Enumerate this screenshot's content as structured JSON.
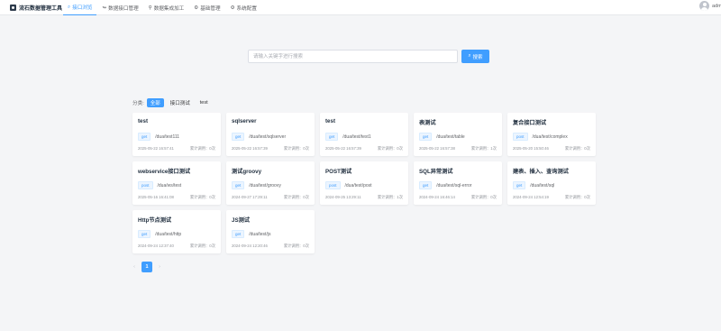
{
  "app": {
    "title": "流石数据管理工具"
  },
  "nav": [
    {
      "label": "接口浏览",
      "icon": "search-icon",
      "glyph": "⌕",
      "active": true
    },
    {
      "label": "数据接口管理",
      "icon": "link-icon",
      "glyph": "↬",
      "active": false
    },
    {
      "label": "数据集成加工",
      "icon": "integration-icon",
      "glyph": "⚲",
      "active": false
    },
    {
      "label": "基础管理",
      "icon": "settings-icon",
      "glyph": "⚙",
      "active": false
    },
    {
      "label": "系统配置",
      "icon": "gear-icon",
      "glyph": "⚙",
      "active": false
    }
  ],
  "user": {
    "name": "admin"
  },
  "search": {
    "placeholder": "请输入关键字进行搜索",
    "value": "",
    "button_label": "搜索",
    "button_icon": "search-icon"
  },
  "filter": {
    "label": "分类:",
    "chips": [
      {
        "label": "全部",
        "active": true
      },
      {
        "label": "接口测试",
        "active": false
      },
      {
        "label": "test",
        "active": false
      }
    ]
  },
  "cards": [
    {
      "title": "test",
      "method": "get",
      "path": "/dua/test111",
      "time": "2025-05-22 16:57:41",
      "calls": "累计调用：0次"
    },
    {
      "title": "sqlserver",
      "method": "get",
      "path": "/dua/test/sqlserver",
      "time": "2025-05-22 16:57:39",
      "calls": "累计调用：0次"
    },
    {
      "title": "test",
      "method": "get",
      "path": "/dua/test/test1",
      "time": "2025-05-22 16:57:39",
      "calls": "累计调用：0次"
    },
    {
      "title": "表测试",
      "method": "get",
      "path": "/dua/test/table",
      "time": "2025-05-22 16:57:38",
      "calls": "累计调用：1次"
    },
    {
      "title": "复合接口测试",
      "method": "post",
      "path": "/dua/test/complex",
      "time": "2025-05-20 15:50:46",
      "calls": "累计调用：0次"
    },
    {
      "title": "webservice接口测试",
      "method": "post",
      "path": "/dua/ws/test",
      "time": "2025-05-16 16:41:08",
      "calls": "累计调用：0次"
    },
    {
      "title": "测试groovy",
      "method": "get",
      "path": "/dua/test/groovy",
      "time": "2024-09-27 17:29:11",
      "calls": "累计调用：0次"
    },
    {
      "title": "POST测试",
      "method": "post",
      "path": "/dua/test/post",
      "time": "2024-09-25 13:29:11",
      "calls": "累计调用：1次"
    },
    {
      "title": "SQL异常测试",
      "method": "get",
      "path": "/dua/test/sql-error",
      "time": "2024-09-24 16:46:14",
      "calls": "累计调用：0次"
    },
    {
      "title": "建表、插入、查询测试",
      "method": "get",
      "path": "/dua/test/sql",
      "time": "2024-09-24 12:54:19",
      "calls": "累计调用：0次"
    },
    {
      "title": "Http节点测试",
      "method": "get",
      "path": "/dua/test/http",
      "time": "2024-09-24 12:37:40",
      "calls": "累计调用：0次"
    },
    {
      "title": "JS测试",
      "method": "get",
      "path": "/dua/test/js",
      "time": "2024-09-24 12:20:46",
      "calls": "累计调用：0次"
    }
  ],
  "pager": {
    "prev": "‹",
    "current": "1",
    "next": "›"
  }
}
